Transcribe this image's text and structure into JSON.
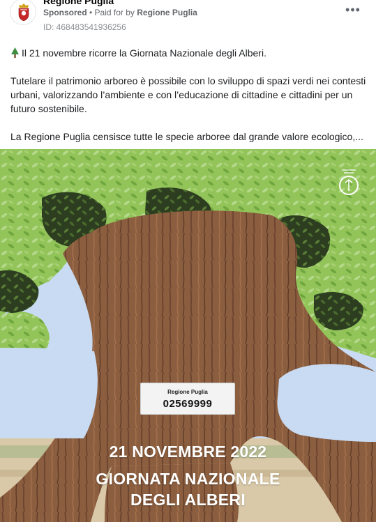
{
  "header": {
    "page_name": "Regione Puglia",
    "sponsored_label": "Sponsored",
    "separator": " • ",
    "paid_prefix": "Paid for by ",
    "advertiser": "Regione Puglia",
    "ad_id": "ID: 468483541936256",
    "more_icon": "more-horizontal-icon"
  },
  "post": {
    "line1": "Il 21 novembre ricorre la Giornata Nazionale degli Alberi.",
    "line1_icon": "tree-emoji-icon",
    "line2": "Tutelare il patrimonio arboreo è possibile con lo sviluppo di spazi verdi nei contesti urbani, valorizzando l’ambiente e con l’educazione di cittadine e cittadini per un futuro sostenibile.",
    "line3": "La Regione Puglia censisce tutte le specie arboree dal grande valore ecologico,..."
  },
  "ad_image": {
    "card_org": "Regione Puglia",
    "card_number": "02569999",
    "date": "21 NOVEMBRE 2022",
    "title_line1": "GIORNATA NAZIONALE",
    "title_line2": "DEGLI ALBERI",
    "badge_icon": "tree-badge-icon",
    "colors": {
      "foliage": "#8cc152",
      "foliage_dark": "#3f5a28",
      "trunk": "#8a5a3f",
      "sky": "#c8dbf3",
      "ground": "#d9c9a8"
    }
  }
}
